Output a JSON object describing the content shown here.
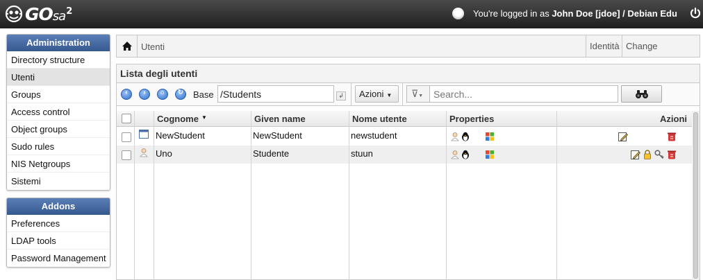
{
  "header": {
    "logo_text": "GO",
    "logo_sub": "sa",
    "logo_sup": "2",
    "login_prefix": "You're logged in as",
    "login_user": "John Doe [jdoe] / Debian Edu"
  },
  "sidebar": {
    "administration": {
      "title": "Administration",
      "items": [
        "Directory structure",
        "Utenti",
        "Groups",
        "Access control",
        "Object groups",
        "Sudo rules",
        "NIS Netgroups",
        "Sistemi"
      ],
      "active": "Utenti"
    },
    "addons": {
      "title": "Addons",
      "items": [
        "Preferences",
        "LDAP tools",
        "Password Management"
      ]
    }
  },
  "breadcrumb": {
    "current": "Utenti",
    "links": [
      "Identità",
      "Change password"
    ]
  },
  "list": {
    "title": "Lista degli utenti",
    "base_label": "Base",
    "base_value": "/Students",
    "actions_label": "Azioni",
    "search_placeholder": "Search...",
    "columns": [
      "Cognome",
      "Given name",
      "Nome utente",
      "Properties",
      "Azioni"
    ],
    "rows": [
      {
        "surname": "NewStudent",
        "given_name": "NewStudent",
        "username": "newstudent"
      },
      {
        "surname": "Uno",
        "given_name": "Studente",
        "username": "stuun"
      }
    ]
  },
  "colors": {
    "panel_header": "#36598f",
    "topbar": "#2a2a2a",
    "delete_icon": "#d33a3a"
  }
}
